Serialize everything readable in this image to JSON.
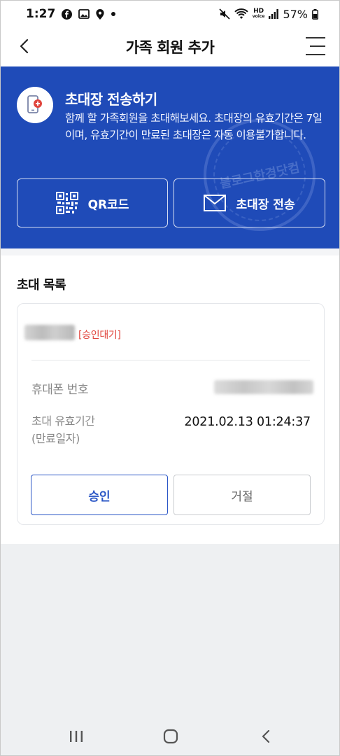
{
  "status_bar": {
    "time": "1:27",
    "battery": "57%",
    "hd_label": "HD",
    "volte_label": "voice"
  },
  "app_bar": {
    "title": "가족 회원 추가"
  },
  "invite_panel": {
    "title": "초대장 전송하기",
    "description": "함께 할 가족회원을 초대해보세요. 초대장의 유효기간은 7일이며, 유효기간이 만료된 초대장은 자동 이용불가합니다.",
    "watermark": "블로그한경닷컴",
    "qr_button_label": "QR코드",
    "send_button_label": "초대장 전송"
  },
  "invite_list": {
    "section_title": "초대 목록",
    "items": [
      {
        "status": "[승인대기]",
        "phone_label": "휴대폰 번호",
        "expiry_label_line1": "초대 유효기간",
        "expiry_label_line2": "(만료일자)",
        "expiry_value": "2021.02.13 01:24:37",
        "approve_label": "승인",
        "reject_label": "거절"
      }
    ]
  },
  "colors": {
    "brand_blue": "#1f4bb8",
    "approve_blue": "#2a56c6",
    "status_red": "#e0453d"
  },
  "icons": {
    "back": "chevron-left-icon",
    "menu": "hamburger-menu-icon",
    "invite": "phone-plus-icon",
    "qr": "qr-code-icon",
    "mail": "envelope-icon",
    "nav_recent": "recent-apps-icon",
    "nav_home": "home-icon",
    "nav_back": "nav-back-icon"
  }
}
